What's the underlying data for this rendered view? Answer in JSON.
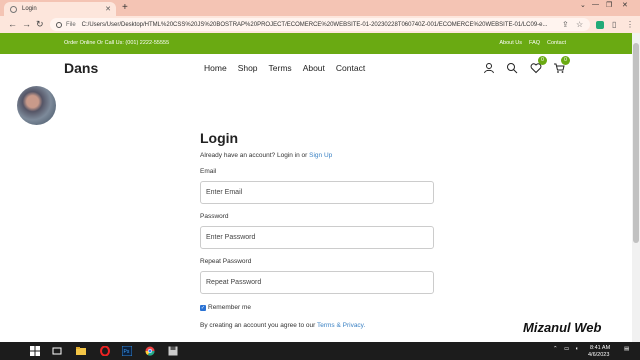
{
  "browser": {
    "tab_title": "Login",
    "url_scheme": "File",
    "url": "C:/Users/User/Desktop/HTML%20CSS%20JS%20BOSTRAP%20PROJECT/ECOMERCE%20WEBSITE-01-20230228T060740Z-001/ECOMERCE%20WEBSITE-01/LC09-e..."
  },
  "topbar": {
    "contact_text": "Order Online Or Call Us: (001) 2222-55555",
    "links": [
      "About Us",
      "FAQ",
      "Contact"
    ]
  },
  "header": {
    "brand": "Dans",
    "menu": [
      "Home",
      "Shop",
      "Terms",
      "About",
      "Contact"
    ],
    "wishlist_count": "0",
    "cart_count": "0",
    "icons": [
      "user-icon",
      "search-icon",
      "heart-icon",
      "cart-icon"
    ]
  },
  "login": {
    "title": "Login",
    "already_text": "Already have an account? Login in or",
    "signup_link": "Sign Up",
    "email_label": "Email",
    "email_placeholder": "Enter Email",
    "password_label": "Password",
    "password_placeholder": "Enter Password",
    "repeat_label": "Repeat Password",
    "repeat_value": "Repeat Password",
    "remember_label": "Remember me",
    "remember_checked": true,
    "terms_text": "By creating an account you agree to our",
    "terms_link": "Terms & Privacy."
  },
  "watermark": "Mizanul Web",
  "taskbar": {
    "time": "8:41 AM",
    "date": "4/6/2023"
  },
  "colors": {
    "accent_green": "#6aaa12",
    "link_blue": "#3b82c4",
    "tab_bar": "#f4c4b4"
  }
}
